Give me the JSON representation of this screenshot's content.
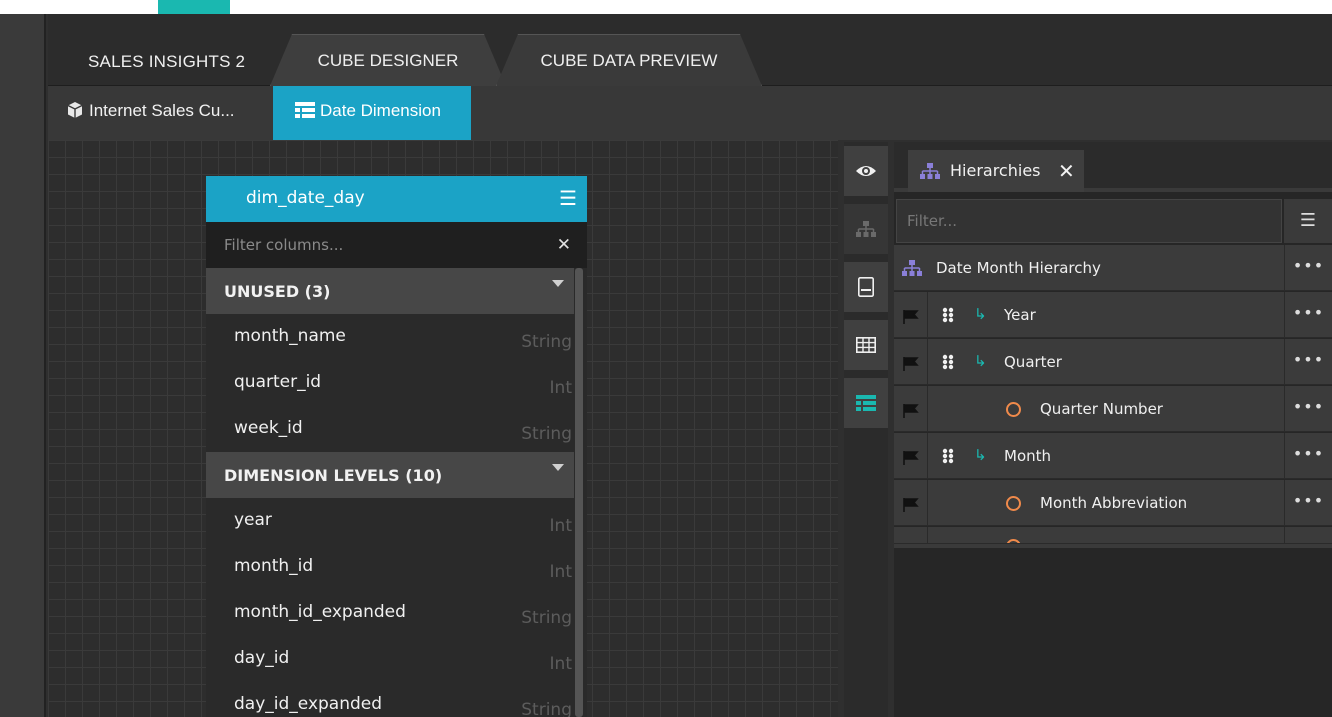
{
  "top_tabs": {
    "project": "SALES INSIGHTS 2",
    "cube_designer": "CUBE DESIGNER",
    "cube_data_preview": "CUBE DATA PREVIEW"
  },
  "sub_tabs": {
    "cube": "Internet Sales Cu...",
    "date_dimension": "Date Dimension"
  },
  "table_card": {
    "title": "dim_date_day",
    "filter_placeholder": "Filter columns...",
    "clear_icon": "x-icon",
    "groups": [
      {
        "label": "UNUSED (3)"
      },
      {
        "label": "DIMENSION LEVELS (10)"
      }
    ],
    "unused_columns": [
      {
        "name": "month_name",
        "type": "String"
      },
      {
        "name": "quarter_id",
        "type": "Int"
      },
      {
        "name": "week_id",
        "type": "String"
      }
    ],
    "level_columns": [
      {
        "name": "year",
        "type": "Int"
      },
      {
        "name": "month_id",
        "type": "Int"
      },
      {
        "name": "month_id_expanded",
        "type": "String"
      },
      {
        "name": "day_id",
        "type": "Int"
      },
      {
        "name": "day_id_expanded",
        "type": "String"
      }
    ]
  },
  "hierarchies_panel": {
    "tab_label": "Hierarchies",
    "close_glyph": "✕",
    "filter_placeholder": "Filter...",
    "more_glyph": "•••",
    "root": "Date Month Hierarchy",
    "levels": [
      {
        "label": "Year",
        "kind": "level"
      },
      {
        "label": "Quarter",
        "kind": "level"
      },
      {
        "label": "Quarter Number",
        "kind": "attribute"
      },
      {
        "label": "Month",
        "kind": "level"
      },
      {
        "label": "Month Abbreviation",
        "kind": "attribute"
      }
    ]
  },
  "colors": {
    "accent_teal": "#1ab8b0",
    "accent_blue": "#1ba3c6",
    "hierarchy_purple": "#8a7fd8",
    "attribute_orange": "#f08a4b"
  }
}
